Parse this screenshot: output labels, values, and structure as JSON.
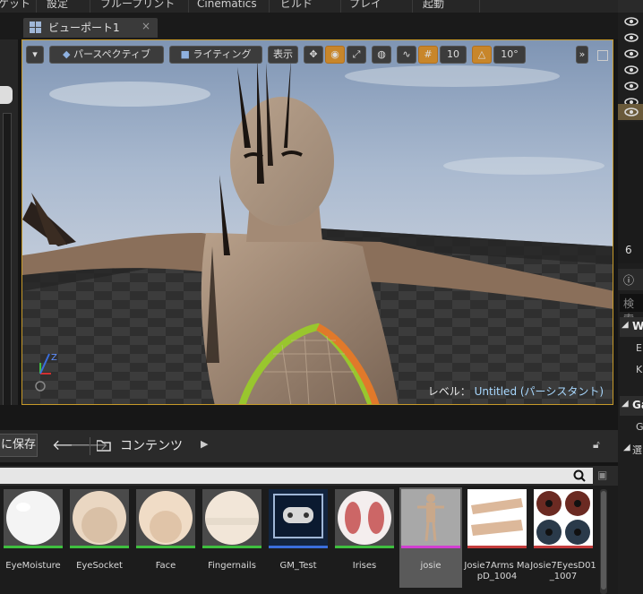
{
  "menu": {
    "items": [
      "ケット",
      "設定",
      "ブループリント",
      "Cinematics",
      "ビルド",
      "プレイ",
      "起動"
    ]
  },
  "viewport_tab": {
    "label": "ビューポート1",
    "close": "×"
  },
  "toolbar": {
    "perspective": "パースペクティブ",
    "lighting": "ライティング",
    "show": "表示",
    "grid_snap": "10",
    "rotate_snap": "10°"
  },
  "viewport": {
    "level_prefix": "レベル：",
    "level_name": "Untitled (パーシスタント)"
  },
  "content_browser": {
    "save": "に保存",
    "path": "コンテンツ",
    "assets": [
      {
        "name": "EyeMoisture",
        "bar_color": "#3fbf3f"
      },
      {
        "name": "EyeSocket",
        "bar_color": "#3fbf3f"
      },
      {
        "name": "Face",
        "bar_color": "#3fbf3f"
      },
      {
        "name": "Fingernails",
        "bar_color": "#3fbf3f"
      },
      {
        "name": "GM_Test",
        "bar_color": "#3a6edc"
      },
      {
        "name": "Irises",
        "bar_color": "#3fbf3f"
      },
      {
        "name": "josie",
        "bar_color": "#d23fd2"
      },
      {
        "name": "Josie7Arms MapD_1004",
        "bar_color": "#c43c3c"
      },
      {
        "name": "Josie7EyesD01 _1007",
        "bar_color": "#c43c3c"
      }
    ]
  },
  "right_panel": {
    "number": "6",
    "search": "検索",
    "w": "W",
    "en": "En",
    "k": "K",
    "ga": "Ga",
    "g": "G",
    "sub": "選"
  }
}
